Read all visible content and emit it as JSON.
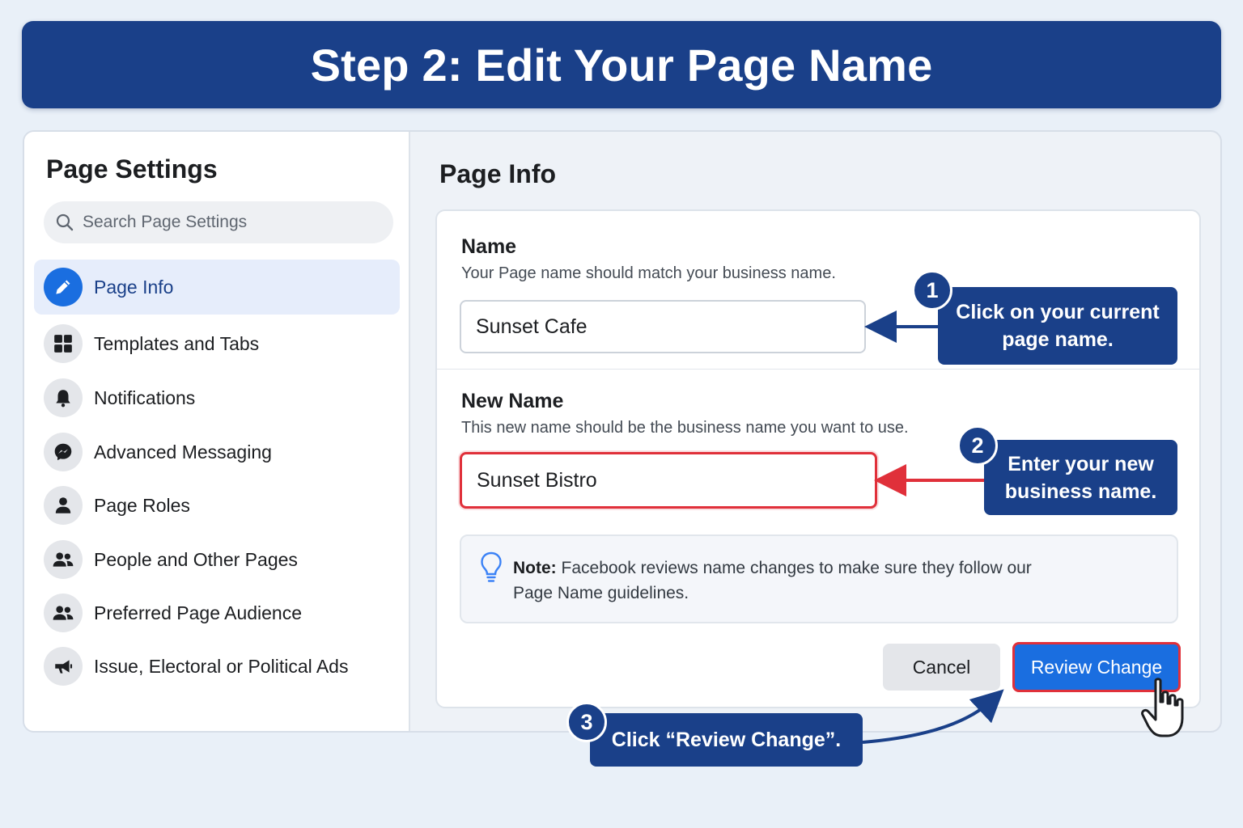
{
  "banner": {
    "title": "Step 2: Edit Your Page Name"
  },
  "sidebar": {
    "title": "Page Settings",
    "search_placeholder": "Search Page Settings",
    "items": [
      {
        "label": "Page Info",
        "icon": "pencil-icon",
        "active": true
      },
      {
        "label": "Templates and Tabs",
        "icon": "grid-icon"
      },
      {
        "label": "Notifications",
        "icon": "bell-icon"
      },
      {
        "label": "Advanced Messaging",
        "icon": "messenger-icon"
      },
      {
        "label": "Page Roles",
        "icon": "person-icon"
      },
      {
        "label": "People and Other Pages",
        "icon": "people-icon"
      },
      {
        "label": "Preferred Page Audience",
        "icon": "audience-icon"
      },
      {
        "label": "Issue, Electoral or Political Ads",
        "icon": "megaphone-icon"
      }
    ]
  },
  "main": {
    "title": "Page Info",
    "name_section": {
      "label": "Name",
      "help": "Your Page name should match your business name.",
      "value": "Sunset Cafe"
    },
    "new_name_section": {
      "label": "New Name",
      "help": "This new name should be the business name you want to use.",
      "value": "Sunset Bistro"
    },
    "note": {
      "bold": "Note:",
      "text": " Facebook reviews name changes to make sure they follow our Page Name guidelines."
    },
    "buttons": {
      "cancel": "Cancel",
      "review": "Review Change"
    }
  },
  "callouts": [
    {
      "number": "1",
      "text": "Click on your current page name."
    },
    {
      "number": "2",
      "text": "Enter your new business name."
    },
    {
      "number": "3",
      "text": "Click “Review Change”."
    }
  ],
  "colors": {
    "brand_blue": "#1a4089",
    "accent_blue": "#1a6ee0",
    "highlight_red": "#e0303a"
  }
}
